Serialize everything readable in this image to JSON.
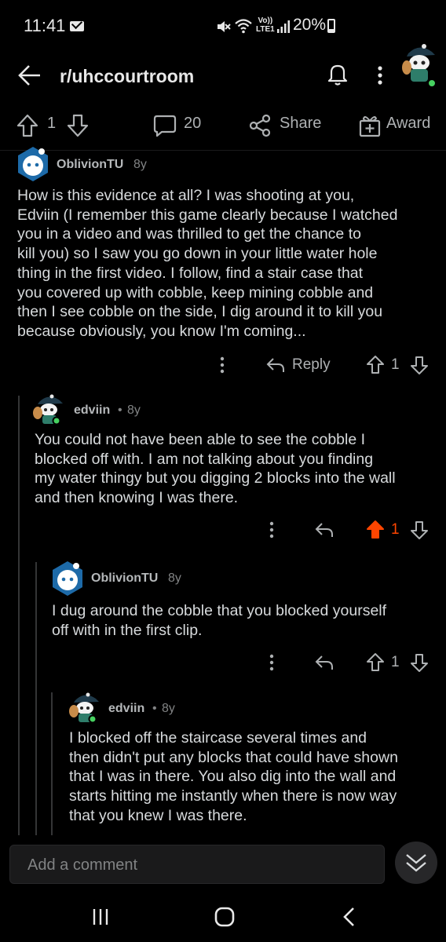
{
  "status_bar": {
    "time": "11:41",
    "network_label_top": "Vo))",
    "network_label_bottom": "LTE1",
    "battery": "20%"
  },
  "header": {
    "title": "r/uhccourtroom",
    "icons": [
      "back-arrow-icon",
      "bell-icon",
      "more-vertical-icon",
      "avatar"
    ]
  },
  "post_actions": {
    "vote_count": "1",
    "comment_count": "20",
    "share_label": "Share",
    "award_label": "Award"
  },
  "comments": [
    {
      "author": "OblivionTU",
      "age": "8y",
      "lines": [
        "How is this evidence at all? I was shooting at you,",
        "Edviin (I remember this game clearly because I watched",
        "you in a video and was thrilled to get the chance to",
        "kill you) so I saw you go down in your little water hole",
        "thing in the first video. I follow, find a stair case that",
        "you covered up with cobble, keep mining cobble and",
        "then I see cobble on the side, I dig around it to kill you",
        "because obviously, you know I'm coming..."
      ],
      "reply_label": "Reply",
      "votes": "1"
    },
    {
      "author": "edviin",
      "age": "8y",
      "lines": [
        "You could not have been able to see the cobble I",
        "blocked off with. I am not talking about you finding",
        "my water thingy but you digging 2 blocks into the wall",
        "and then knowing I was there."
      ],
      "votes": "1",
      "upvoted_color": "#ff4500"
    },
    {
      "author": "OblivionTU",
      "age": "8y",
      "lines": [
        "I dug around the cobble that you blocked yourself",
        "off with in the first clip."
      ],
      "votes": "1"
    },
    {
      "author": "edviin",
      "age": "8y",
      "lines": [
        "I blocked off the staircase several times and",
        "then didn't put any blocks that could have shown",
        "that I was in there. You also dig into the wall and",
        "starts hitting me instantly when there is now way",
        "that you knew I was there."
      ]
    }
  ],
  "comment_bar": {
    "placeholder": "Add a comment"
  },
  "colors": {
    "background": "#000000",
    "text": "#d7dadc",
    "muted": "#818384",
    "upvote": "#ff4500",
    "online": "#46d160"
  }
}
